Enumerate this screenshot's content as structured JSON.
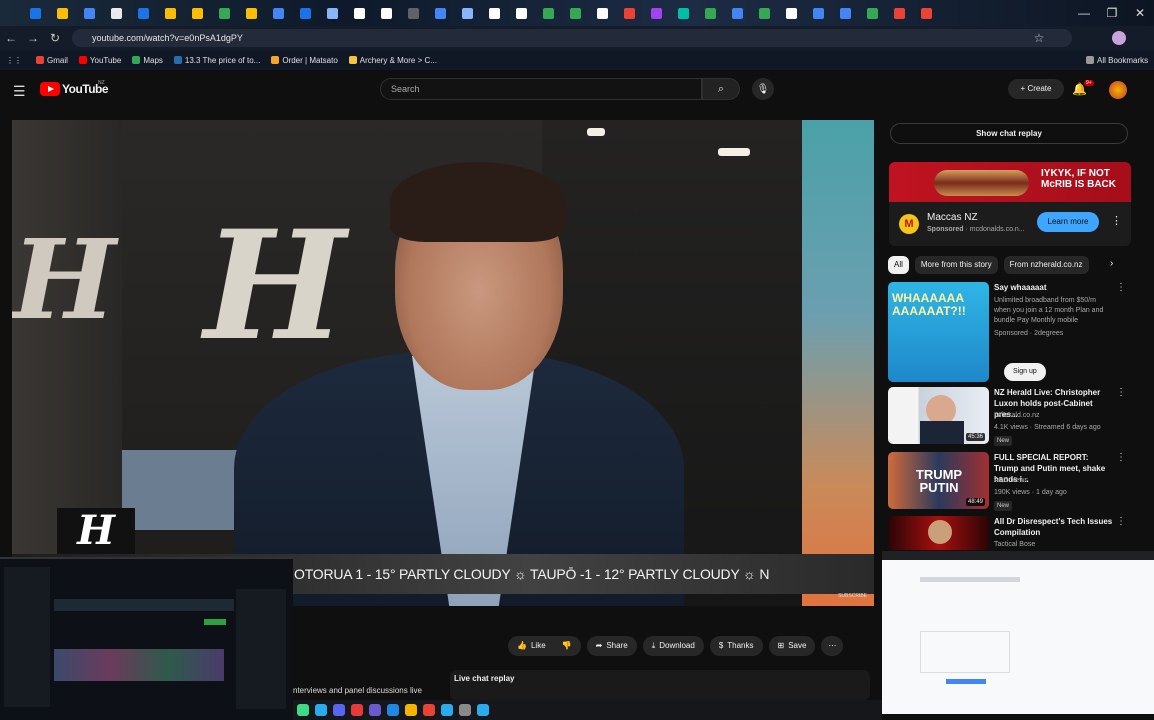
{
  "browser": {
    "url": "youtube.com/watch?v=e0nPsA1dgPY",
    "bookmarks": [
      "Gmail",
      "YouTube",
      "Maps",
      "13.3 The price of to...",
      "Order | Matsato",
      "Archery & More > C..."
    ],
    "all_bookmarks": "All Bookmarks",
    "tab_colors": [
      "#1a73e8",
      "#fbbc04",
      "#4285f4",
      "#e8eaed",
      "#1a73e8",
      "#fbbc04",
      "#fbbc04",
      "#34a853",
      "#fbbc04",
      "#4285f4",
      "#1a73e8",
      "#8ab4f8",
      "#ffffff",
      "#ffffff",
      "#5f6368",
      "#4285f4",
      "#8ab4f8",
      "#ffffff",
      "#ffffff",
      "#34a853",
      "#34a853",
      "#ffffff",
      "#ea4335",
      "#a142f4",
      "#00bfa5",
      "#34a853",
      "#4285f4",
      "#34a853",
      "#ffffff",
      "#4285f4",
      "#4285f4",
      "#34a853",
      "#ea4335",
      "#ea4335"
    ]
  },
  "youtube": {
    "logo": "YouTube",
    "region": "NZ",
    "search_placeholder": "Search",
    "create_label": "Create",
    "notif_count": "9+"
  },
  "player": {
    "ticker": "OTORUA 1 - 15° PARTLY CLOUDY   ☼ TAUPŌ -1 - 12° PARTLY CLOUDY   ☼ N",
    "subscribe": "SUBSCRIBE",
    "brand_mark": "H"
  },
  "actions": {
    "like": "Like",
    "share": "Share",
    "download": "Download",
    "thanks": "Thanks",
    "save": "Save"
  },
  "below": {
    "description_snip": "nterviews and panel discussions live",
    "live_chat": "Live chat replay"
  },
  "sidebar": {
    "show_chat": "Show chat replay",
    "ad": {
      "headline": "IYKYK, IF NOT McRIB IS BACK",
      "advertiser": "Maccas NZ",
      "sponsored": "Sponsored",
      "domain": "mcdonalds.co.n...",
      "cta": "Learn more"
    },
    "chips": [
      "All",
      "More from this story",
      "From nzherald.co.nz"
    ],
    "recs": [
      {
        "title": "Say whaaaaat",
        "channel": "Unlimited broadband from $50/m when you join a 12 month Plan and bundle Pay Monthly mobile",
        "meta": "Sponsored · 2degrees",
        "cta": "Sign up",
        "thumb": "WHAAAAAA AAAAAAT?!!"
      },
      {
        "title": "NZ Herald Live: Christopher Luxon holds post-Cabinet pres...",
        "channel": "nzherald.co.nz",
        "meta": "4.1K views · Streamed 6 days ago",
        "badge": "New",
        "duration": "45:36"
      },
      {
        "title": "FULL SPECIAL REPORT: Trump and Putin meet, shake hands i...",
        "channel": "ABC News",
        "meta": "190K views · 1 day ago",
        "badge": "New",
        "duration": "48:49",
        "thumb": "TRUMP PUTIN"
      },
      {
        "title": "All Dr Disrespect's Tech Issues Compilation",
        "channel": "Tactical Bose"
      }
    ]
  },
  "taskbar_colors": [
    "#3ddc84",
    "#2aabee",
    "#5865f2",
    "#e83a3a",
    "#6a5acd",
    "#1e88e5",
    "#f4b400",
    "#ea4335",
    "#2aabee",
    "#8a8a8a",
    "#2aabee"
  ]
}
